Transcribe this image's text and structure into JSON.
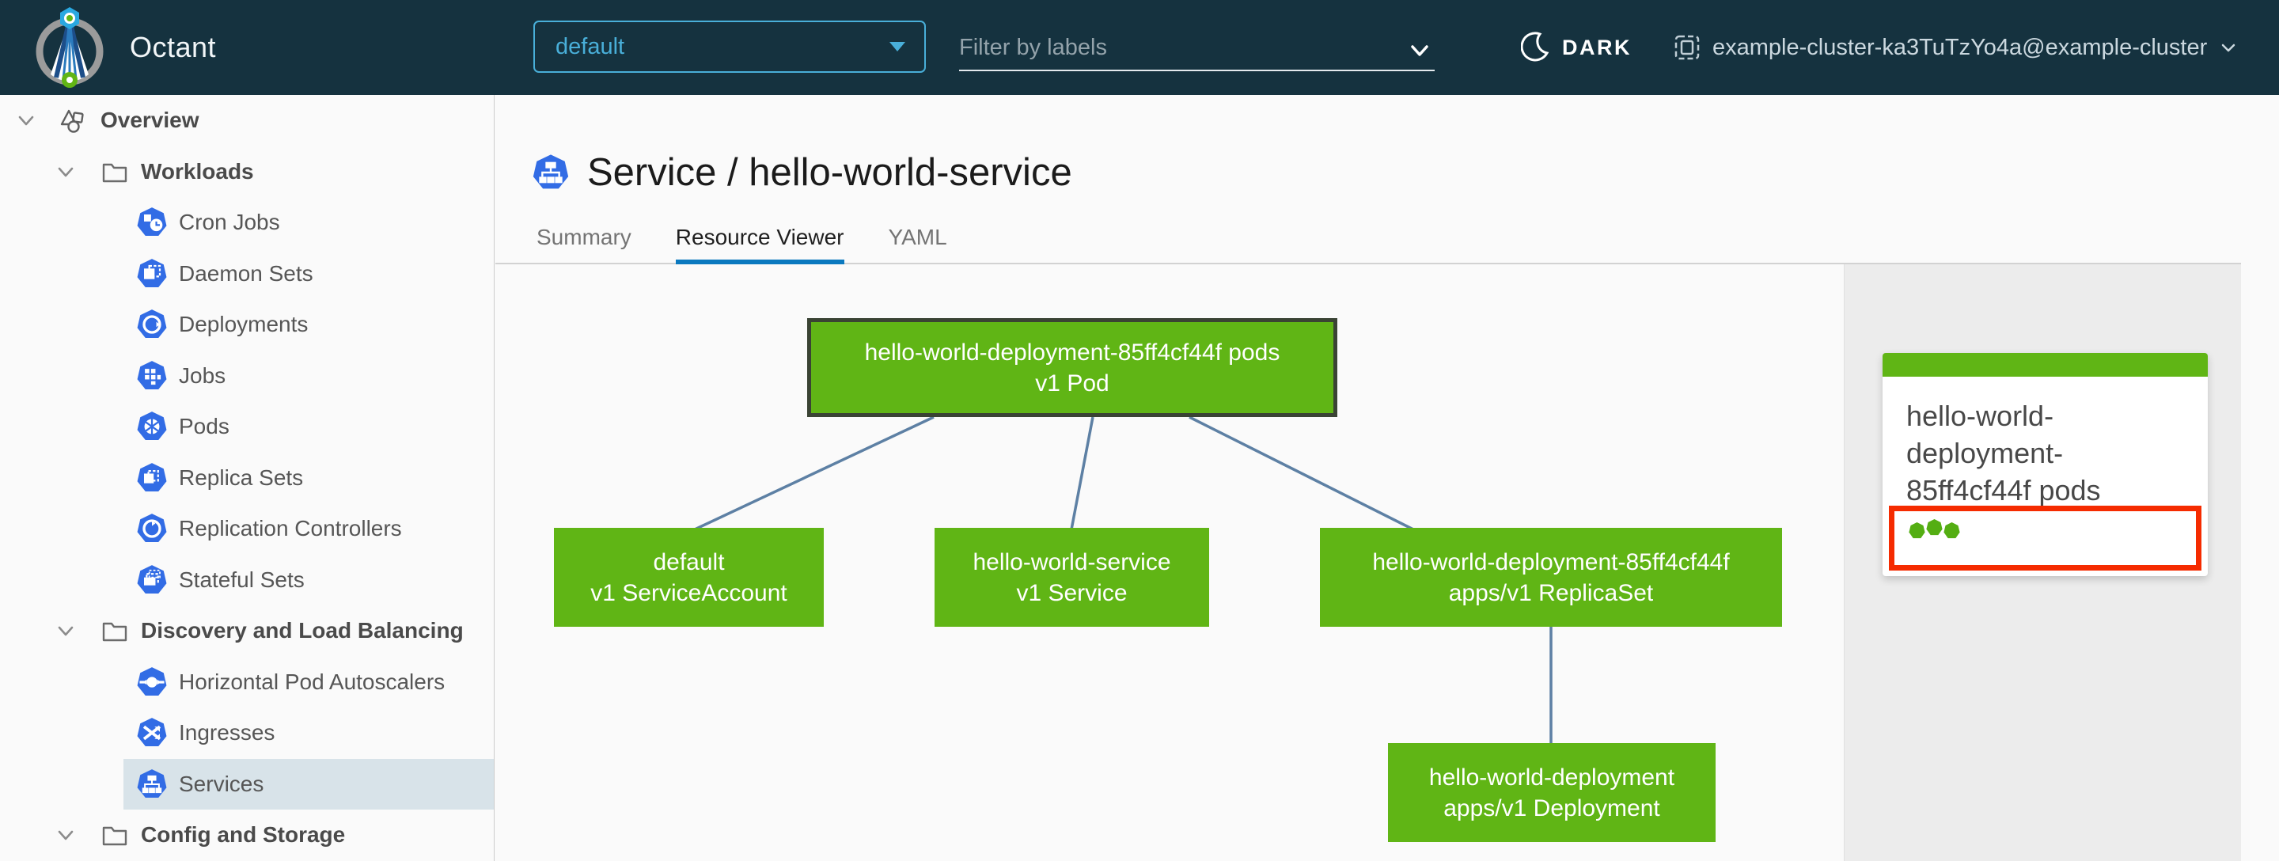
{
  "header": {
    "app_name": "Octant",
    "namespace_dropdown": {
      "value": "default"
    },
    "label_filter": {
      "placeholder": "Filter by labels"
    },
    "theme_toggle": {
      "label": "DARK"
    },
    "context_selector": {
      "value": "example-cluster-ka3TuTzYo4a@example-cluster"
    }
  },
  "sidebar": {
    "items": [
      {
        "label": "Overview"
      },
      {
        "label": "Workloads"
      },
      {
        "label": "Cron Jobs"
      },
      {
        "label": "Daemon Sets"
      },
      {
        "label": "Deployments"
      },
      {
        "label": "Jobs"
      },
      {
        "label": "Pods"
      },
      {
        "label": "Replica Sets"
      },
      {
        "label": "Replication Controllers"
      },
      {
        "label": "Stateful Sets"
      },
      {
        "label": "Discovery and Load Balancing"
      },
      {
        "label": "Horizontal Pod Autoscalers"
      },
      {
        "label": "Ingresses"
      },
      {
        "label": "Services",
        "selected": true
      },
      {
        "label": "Config and Storage"
      }
    ]
  },
  "main": {
    "title": "Service / hello-world-service",
    "tabs": [
      {
        "label": "Summary",
        "active": false
      },
      {
        "label": "Resource Viewer",
        "active": true
      },
      {
        "label": "YAML",
        "active": false
      }
    ]
  },
  "graph": {
    "nodes": [
      {
        "id": "pod",
        "line1": "hello-world-deployment-85ff4cf44f pods",
        "line2": "v1 Pod",
        "selected": true
      },
      {
        "id": "serviceaccount",
        "line1": "default",
        "line2": "v1 ServiceAccount"
      },
      {
        "id": "service",
        "line1": "hello-world-service",
        "line2": "v1 Service"
      },
      {
        "id": "replicaset",
        "line1": "hello-world-deployment-85ff4cf44f",
        "line2": "apps/v1 ReplicaSet"
      },
      {
        "id": "deployment",
        "line1": "hello-world-deployment",
        "line2": "apps/v1 Deployment"
      }
    ],
    "edges": [
      [
        "pod",
        "serviceaccount"
      ],
      [
        "pod",
        "service"
      ],
      [
        "pod",
        "replicaset"
      ],
      [
        "replicaset",
        "deployment"
      ]
    ]
  },
  "detail_panel": {
    "card_title": "hello-world-deployment-85ff4cf44f pods",
    "status_dot_count": 3
  },
  "colors": {
    "header_bg": "#15323F",
    "accent_blue": "#49afd9",
    "k8s_icon_blue": "#326ce5",
    "node_green": "#60b515",
    "tab_underline_blue": "#0b79bf",
    "selected_row_bg": "#d8e3e9",
    "status_border_red": "#f52b00",
    "edge_blue_gray": "#5d80a4",
    "panel_gray": "#ececec"
  }
}
